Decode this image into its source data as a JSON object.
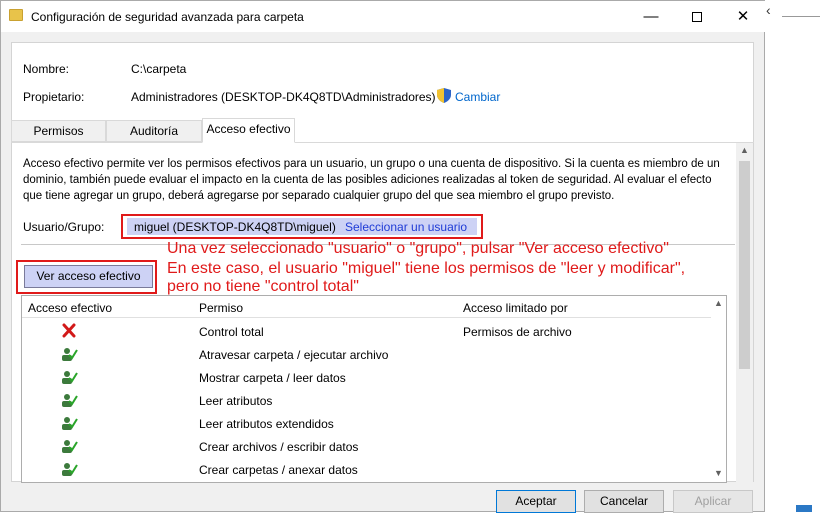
{
  "window": {
    "title": "Configuración de seguridad avanzada para carpeta",
    "minimize": "—",
    "close": "✕"
  },
  "fields": {
    "name_label": "Nombre:",
    "name_value": "C:\\carpeta",
    "owner_label": "Propietario:",
    "owner_value": "Administradores (DESKTOP-DK4Q8TD\\Administradores)",
    "change_link": "Cambiar"
  },
  "tabs": [
    {
      "label": "Permisos"
    },
    {
      "label": "Auditoría"
    },
    {
      "label": "Acceso efectivo"
    }
  ],
  "description": "Acceso efectivo permite ver los permisos efectivos para un usuario, un grupo o una cuenta de dispositivo. Si la cuenta es miembro de un dominio, también puede evaluar el impacto en la cuenta de las posibles adiciones realizadas al token de seguridad. Al evaluar el efecto que tiene agregar un grupo, deberá agregarse por separado cualquier grupo del que sea miembro el grupo previsto.",
  "user_group": {
    "label": "Usuario/Grupo:",
    "value": "miguel (DESKTOP-DK4Q8TD\\miguel)",
    "select_link": "Seleccionar un usuario"
  },
  "annotation": {
    "line1": "Una vez seleccionado \"usuario\" o \"grupo\", pulsar \"Ver acceso efectivo\"",
    "line2": "En este caso, el usuario \"miguel\" tiene los permisos de \"leer y modificar\",",
    "line3": "pero no tiene \"control total\""
  },
  "view_button": "Ver acceso efectivo",
  "grid": {
    "headers": [
      "Acceso efectivo",
      "Permiso",
      "Acceso limitado por"
    ],
    "rows": [
      {
        "icon": "denied-icon",
        "permission": "Control total",
        "limited_by": "Permisos de archivo"
      },
      {
        "icon": "user-check-icon",
        "permission": "Atravesar carpeta / ejecutar archivo",
        "limited_by": ""
      },
      {
        "icon": "user-check-icon",
        "permission": "Mostrar carpeta / leer datos",
        "limited_by": ""
      },
      {
        "icon": "user-check-icon",
        "permission": "Leer atributos",
        "limited_by": ""
      },
      {
        "icon": "user-check-icon",
        "permission": "Leer atributos extendidos",
        "limited_by": ""
      },
      {
        "icon": "user-check-icon",
        "permission": "Crear archivos / escribir datos",
        "limited_by": ""
      },
      {
        "icon": "user-check-icon",
        "permission": "Crear carpetas / anexar datos",
        "limited_by": ""
      }
    ]
  },
  "buttons": {
    "ok": "Aceptar",
    "cancel": "Cancelar",
    "apply": "Aplicar"
  },
  "colors": {
    "highlight": "#cdd2f5",
    "annotation": "#e01a1a",
    "link": "#0066cc"
  }
}
